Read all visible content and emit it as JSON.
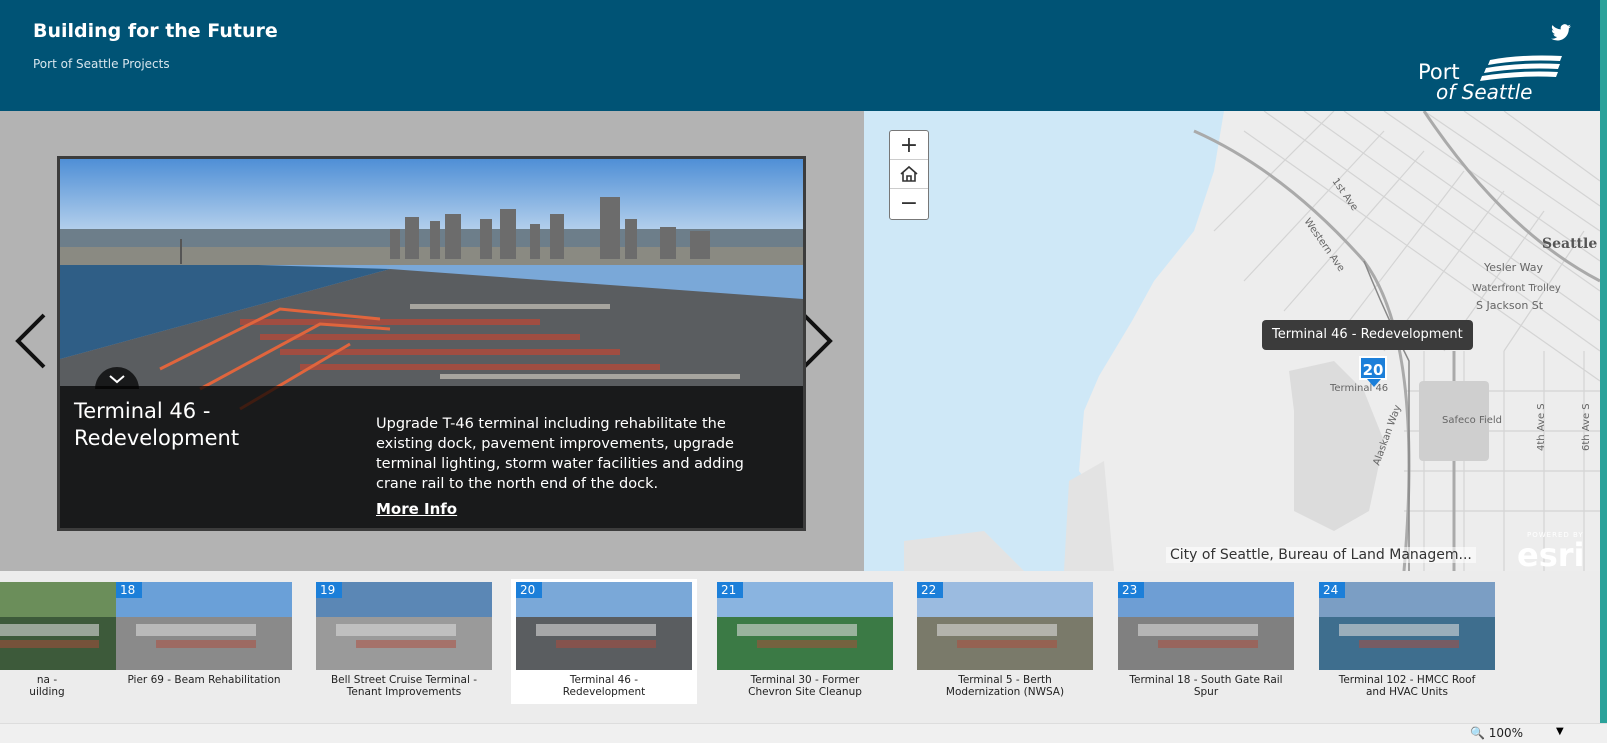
{
  "header": {
    "title": "Building for the Future",
    "subtitle": "Port of Seattle Projects",
    "logo_line1": "Port",
    "logo_line2": "of Seattle"
  },
  "story": {
    "title": "Terminal 46 - Redevelopment",
    "description": "Upgrade T-46 terminal including rehabilitate the existing dock, pavement improvements, upgrade terminal lighting, storm water facilities and adding crane rail to the north end of the dock.",
    "link": "More Info"
  },
  "map": {
    "tooltip": "Terminal 46 - Redevelopment",
    "pin_number": "20",
    "attribution": "City of Seattle, Bureau of Land Managem...",
    "esri_powered": "POWERED BY",
    "esri": "esri",
    "labels": {
      "seattle": "Seattle",
      "yesler": "Yesler Way",
      "waterfront": "Waterfront Trolley",
      "jackson": "S Jackson St",
      "safeco": "Safeco Field",
      "terminal46": "Terminal 46",
      "alaskan": "Alaskan Way",
      "western": "Western Ave",
      "first": "1st Ave",
      "fourth": "4th Ave S",
      "sixth": "6th Ave S"
    }
  },
  "carousel": {
    "items": [
      {
        "number": "",
        "label": "na -\nuilding"
      },
      {
        "number": "18",
        "label": "Pier 69 - Beam Rehabilitation"
      },
      {
        "number": "19",
        "label": "Bell Street Cruise Terminal -\nTenant Improvements"
      },
      {
        "number": "20",
        "label": "Terminal 46 -\nRedevelopment"
      },
      {
        "number": "21",
        "label": "Terminal 30 - Former\nChevron Site Cleanup"
      },
      {
        "number": "22",
        "label": "Terminal 5 - Berth\nModernization (NWSA)"
      },
      {
        "number": "23",
        "label": "Terminal 18 - South Gate Rail\nSpur"
      },
      {
        "number": "24",
        "label": "Terminal 102 - HMCC Roof\nand HVAC Units"
      }
    ]
  },
  "status": {
    "zoom": "100%"
  },
  "colors": {
    "header": "#005375",
    "badge": "#1c7fd9"
  }
}
